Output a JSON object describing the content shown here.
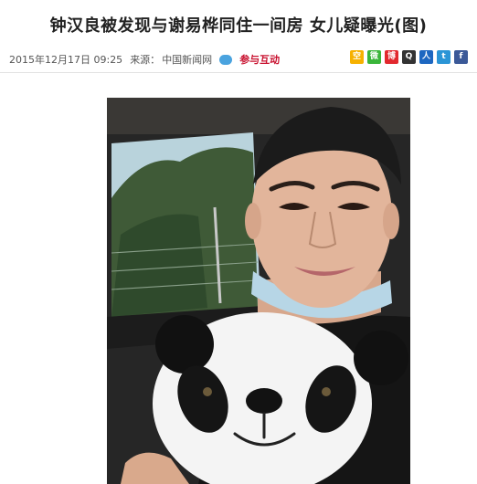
{
  "article": {
    "headline": "钟汉良被发现与谢易桦同住一间房 女儿疑曝光(图)",
    "date": "2015年12月17日 09:25",
    "source_label": "来源：",
    "source": "中国新闻网",
    "interact_label": "参与互动"
  },
  "share_icons": [
    {
      "name": "share-qzone-icon",
      "glyph": "空",
      "color": "#f6b100"
    },
    {
      "name": "share-wechat-icon",
      "glyph": "微",
      "color": "#3ab53a"
    },
    {
      "name": "share-weibo-icon",
      "glyph": "博",
      "color": "#e2282e"
    },
    {
      "name": "share-qq-icon",
      "glyph": "Q",
      "color": "#333333"
    },
    {
      "name": "share-renren-icon",
      "glyph": "人",
      "color": "#1d67c1"
    },
    {
      "name": "share-tencent-weibo-icon",
      "glyph": "t",
      "color": "#2b95d6"
    },
    {
      "name": "share-facebook-icon",
      "glyph": "f",
      "color": "#3b5998"
    }
  ]
}
